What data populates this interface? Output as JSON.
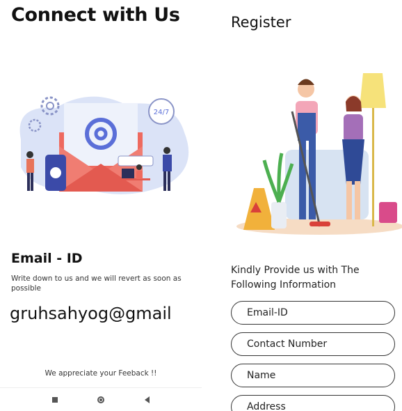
{
  "connect": {
    "title": "Connect with Us",
    "email_section": {
      "title": "Email - ID",
      "description": "Write down to us and we will revert as soon as possible",
      "email_value": "gruhsahyog@gmail"
    },
    "illustration_badge": "24/7",
    "appreciation": "We appreciate your Feeback !!"
  },
  "register": {
    "title": "Register",
    "info": "Kindly Provide us with The Following Information",
    "fields": [
      {
        "placeholder": "Email-ID"
      },
      {
        "placeholder": "Contact Number"
      },
      {
        "placeholder": "Name"
      },
      {
        "placeholder": "Address"
      }
    ]
  },
  "navbar": {
    "icons": [
      "recents-square-icon",
      "home-circle-icon",
      "back-triangle-icon"
    ]
  },
  "colors": {
    "accent_blue": "#5b6fd8",
    "envelope_red": "#ee6a5f",
    "light_blue": "#dbe3f7"
  }
}
